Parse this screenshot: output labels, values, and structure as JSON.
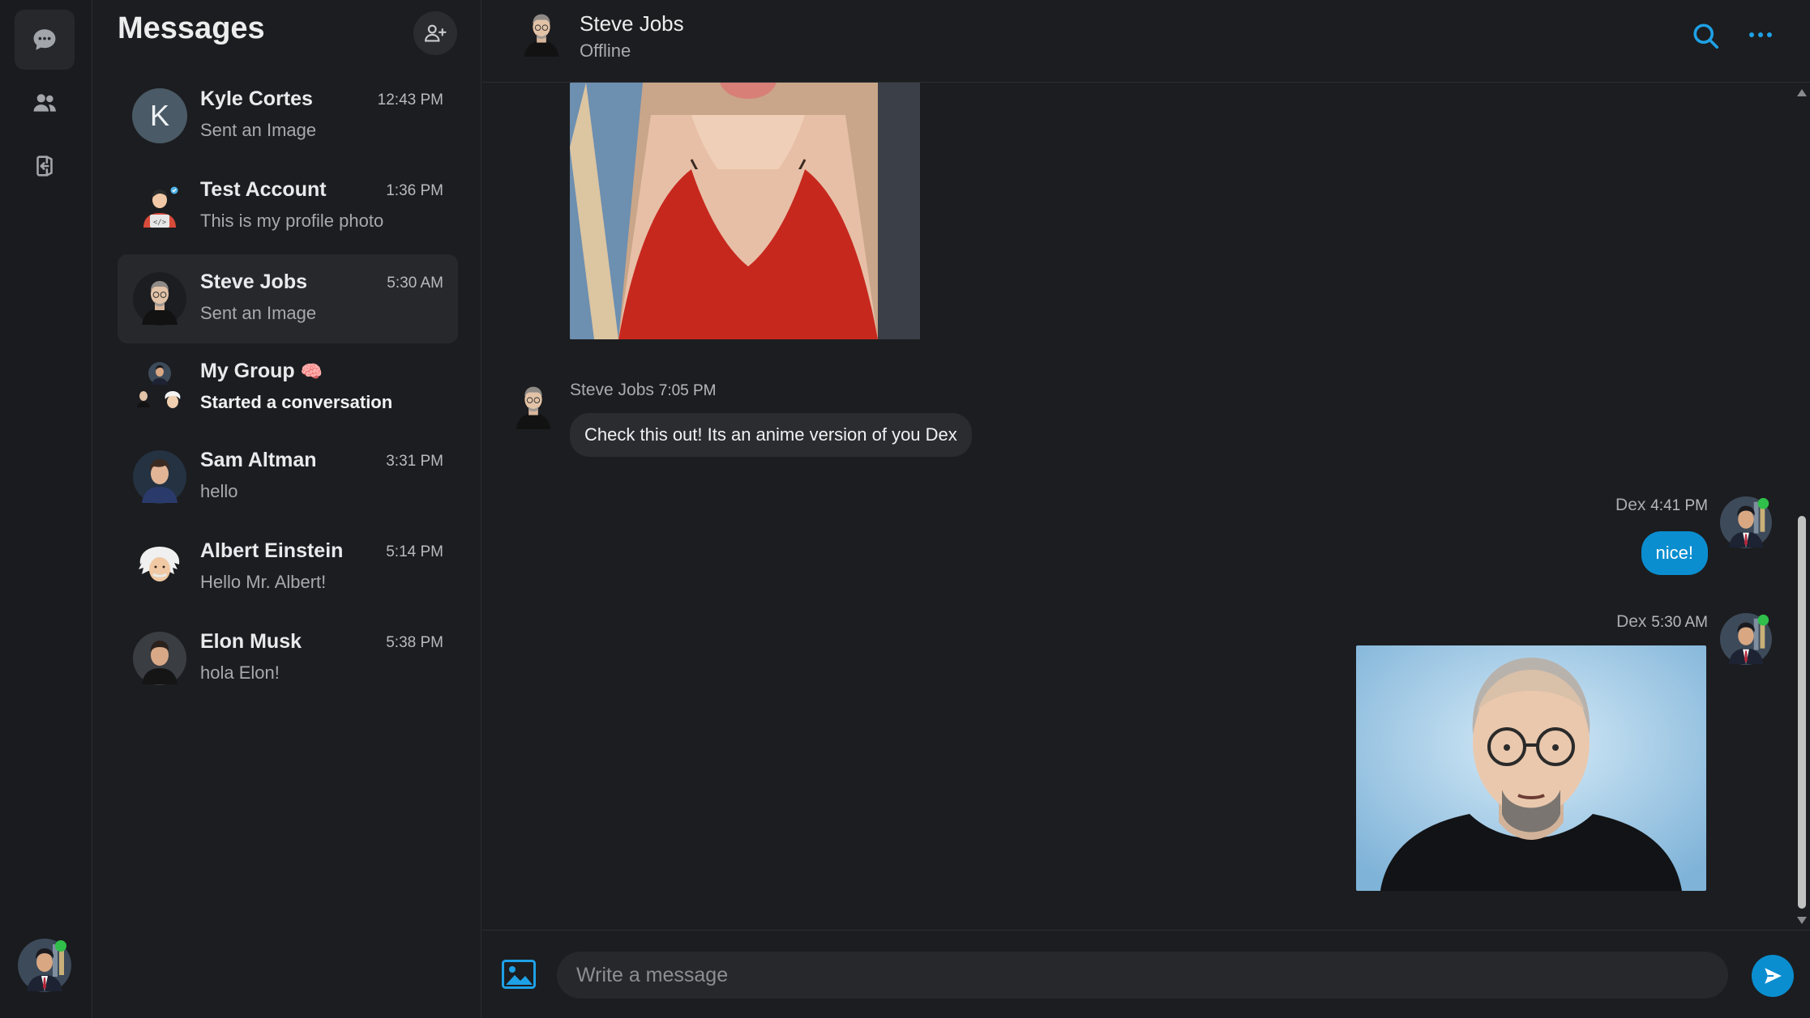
{
  "sidebar": {
    "current_user_status": "online"
  },
  "conversation_list": {
    "title": "Messages",
    "items": [
      {
        "name": "Kyle Cortes",
        "time": "12:43 PM",
        "preview": "Sent an Image",
        "avatar_letter": "K"
      },
      {
        "name": "Test Account",
        "time": "1:36 PM",
        "preview": "This is my profile photo"
      },
      {
        "name": "Steve Jobs",
        "time": "5:30 AM",
        "preview": "Sent an Image",
        "selected": true
      },
      {
        "name": "My Group",
        "emoji": "🧠",
        "time": "",
        "preview": "Started a conversation",
        "unread": true
      },
      {
        "name": "Sam Altman",
        "time": "3:31 PM",
        "preview": "hello"
      },
      {
        "name": "Albert Einstein",
        "time": "5:14 PM",
        "preview": "Hello Mr. Albert!"
      },
      {
        "name": "Elon Musk",
        "time": "5:38 PM",
        "preview": "hola Elon!"
      }
    ]
  },
  "chat": {
    "contact_name": "Steve Jobs",
    "contact_status": "Offline",
    "messages": [
      {
        "sender": "Steve Jobs",
        "time": "7:05 PM",
        "text": "Check this out! Its an anime version of you Dex",
        "direction": "incoming"
      },
      {
        "sender": "Dex",
        "time": "4:41 PM",
        "text": "nice!",
        "direction": "outgoing"
      },
      {
        "sender": "Dex",
        "time": "5:30 AM",
        "type": "image",
        "direction": "outgoing"
      }
    ]
  },
  "composer": {
    "placeholder": "Write a message"
  },
  "colors": {
    "accent": "#0a8ed0",
    "background": "#1c1d20",
    "online": "#2fbf4a"
  }
}
